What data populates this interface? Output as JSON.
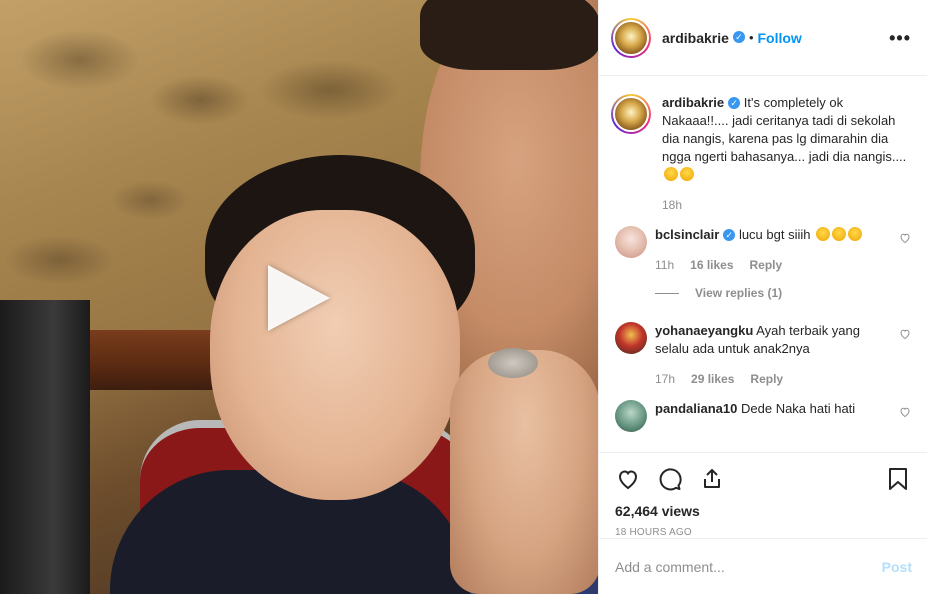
{
  "post": {
    "author": "ardibakrie",
    "follow_label": "Follow",
    "more_label": "•••"
  },
  "caption": {
    "username": "ardibakrie",
    "text": "It's completely ok Nakaaa!!.... jadi ceritanya tadi di sekolah dia nangis, karena pas lg dimarahin dia ngga ngerti bahasanya... jadi dia nangis....",
    "time": "18h"
  },
  "comments": [
    {
      "username": "bclsinclair",
      "verified": true,
      "text": "lucu bgt siiih",
      "time": "11h",
      "likes": "16 likes",
      "reply_label": "Reply",
      "view_replies": "View replies (1)"
    },
    {
      "username": "yohanaeyangku",
      "verified": false,
      "text": "Ayah terbaik yang selalu ada untuk anak2nya",
      "time": "17h",
      "likes": "29 likes",
      "reply_label": "Reply"
    },
    {
      "username": "pandaliana10",
      "verified": false,
      "text": "Dede Naka hati hati"
    }
  ],
  "stats": {
    "views": "62,464 views",
    "posted": "18 HOURS AGO"
  },
  "composer": {
    "placeholder": "Add a comment...",
    "post_label": "Post"
  },
  "icons": {
    "like": "heart-icon",
    "comment": "comment-icon",
    "share": "share-icon",
    "save": "bookmark-icon",
    "play": "play-icon",
    "verified": "verified-badge-icon"
  },
  "colors": {
    "accent": "#0095f6",
    "verified": "#3897f0",
    "muted": "#8e8e8e",
    "post_disabled": "#b2dffc"
  }
}
